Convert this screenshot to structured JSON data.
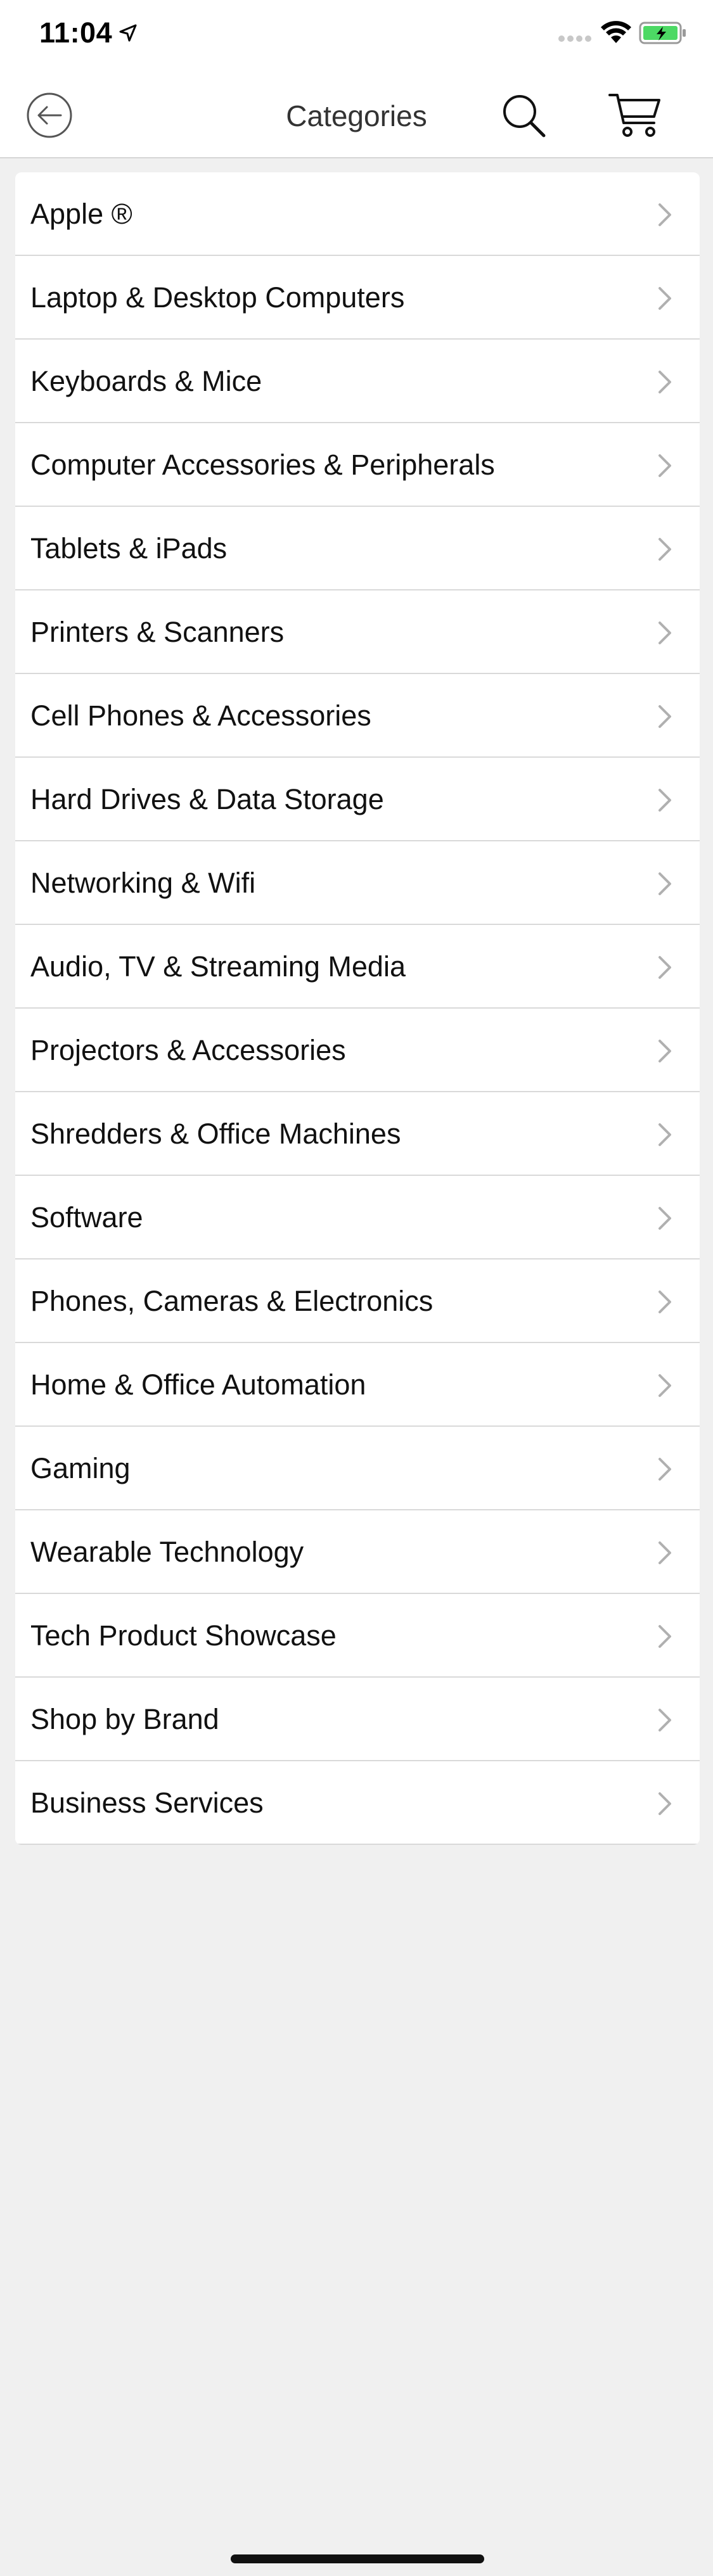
{
  "status_bar": {
    "time": "11:04"
  },
  "header": {
    "title": "Categories"
  },
  "categories": [
    {
      "label": "Apple ®"
    },
    {
      "label": "Laptop & Desktop Computers"
    },
    {
      "label": "Keyboards & Mice"
    },
    {
      "label": "Computer Accessories & Peripherals"
    },
    {
      "label": "Tablets & iPads"
    },
    {
      "label": "Printers & Scanners"
    },
    {
      "label": "Cell Phones & Accessories"
    },
    {
      "label": "Hard Drives & Data Storage"
    },
    {
      "label": "Networking & Wifi"
    },
    {
      "label": "Audio, TV & Streaming Media"
    },
    {
      "label": "Projectors & Accessories"
    },
    {
      "label": "Shredders & Office Machines"
    },
    {
      "label": "Software"
    },
    {
      "label": "Phones, Cameras & Electronics"
    },
    {
      "label": "Home & Office Automation"
    },
    {
      "label": "Gaming"
    },
    {
      "label": "Wearable Technology"
    },
    {
      "label": "Tech Product Showcase"
    },
    {
      "label": "Shop by Brand"
    },
    {
      "label": "Business Services"
    }
  ],
  "icons": {
    "status": [
      "location-arrow-icon",
      "cellular-signal-icon",
      "wifi-icon",
      "battery-charging-icon"
    ],
    "header": [
      "back-arrow-icon",
      "search-icon",
      "cart-icon"
    ],
    "row": "chevron-right-icon"
  },
  "colors": {
    "battery_fill": "#4cd964",
    "background": "#f0f0f0",
    "row_background": "#ffffff",
    "divider": "#d9d9d9",
    "chevron": "#b0b0b0"
  }
}
